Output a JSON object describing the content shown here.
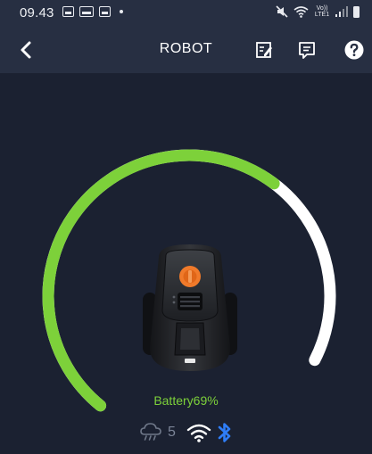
{
  "status_bar": {
    "time": "09.43",
    "volte_top": "Vo))",
    "volte_bottom": "LTE1"
  },
  "header": {
    "title": "ROBOT",
    "icons": [
      "back-arrow-icon",
      "edit-note-icon",
      "message-icon",
      "help-icon"
    ]
  },
  "gauge": {
    "level": 0.69,
    "colors": {
      "filled": "#7dd13a",
      "empty": "#ffffff"
    }
  },
  "robot": {
    "image": "robotic-lawn-mower",
    "accent": "#f07a2a"
  },
  "battery": {
    "label": "Battery69%"
  },
  "connectivity": {
    "rain_count": "5",
    "icons": [
      "rain-cloud-icon",
      "wifi-icon",
      "bluetooth-icon"
    ],
    "colors": {
      "rain": "#6f7889",
      "wifi": "#ffffff",
      "bluetooth": "#2f7df6"
    }
  }
}
